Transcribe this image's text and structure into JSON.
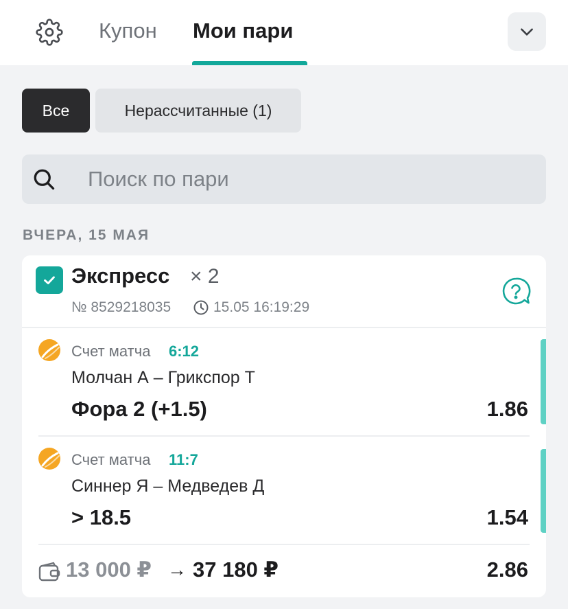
{
  "header": {
    "tabs": [
      {
        "label": "Купон",
        "active": false
      },
      {
        "label": "Мои пари",
        "active": true
      }
    ],
    "accent_color": "#12a89a"
  },
  "filters": [
    {
      "label": "Все",
      "selected": true
    },
    {
      "label": "Нерассчитанные (1)",
      "selected": false
    }
  ],
  "search": {
    "placeholder": "Поиск по пари",
    "value": ""
  },
  "date_label": "ВЧЕРА, 15 МАЯ",
  "bet": {
    "type": "Экспресс",
    "count": "× 2",
    "number": "№ 8529218035",
    "datetime": "15.05 16:19:29",
    "selections": [
      {
        "sport_icon": "tennis-ball-icon",
        "score_label": "Счет матча",
        "score": "6:12",
        "teams": "Молчан А – Грикспор Т",
        "pick": "Фора 2 (+1.5)",
        "odds": "1.86"
      },
      {
        "sport_icon": "tennis-ball-icon",
        "score_label": "Счет матча",
        "score": "11:7",
        "teams": "Синнер Я – Медведев Д",
        "pick": "> 18.5",
        "odds": "1.54"
      }
    ],
    "stake": "13 000 ₽",
    "arrow": "→",
    "payout": "37 180 ₽",
    "total_odds": "2.86"
  }
}
